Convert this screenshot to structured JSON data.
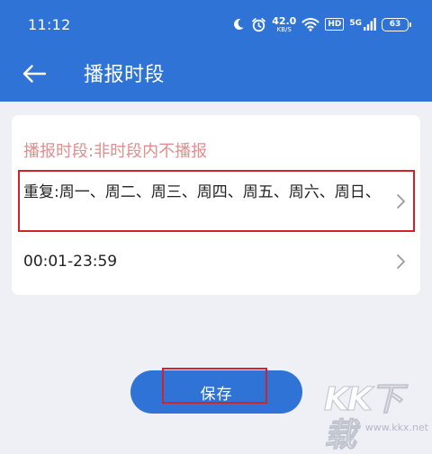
{
  "status_bar": {
    "time": "11:12",
    "net_speed_value": "42.0",
    "net_speed_unit": "KB/S",
    "hd_badge": "HD",
    "network_type": "5G",
    "battery_level": "63"
  },
  "app_bar": {
    "title": "播报时段",
    "back_icon": "arrow-left-icon"
  },
  "card": {
    "hint": "播报时段:非时段内不播报",
    "repeat_row": {
      "text": "重复:周一、周二、周三、周四、周五、周六、周日、"
    },
    "time_row": {
      "text": "00:01-23:59"
    },
    "chevron_icon": "chevron-right-icon"
  },
  "save_button": {
    "label": "保存"
  },
  "watermark": {
    "logo": "KK下载",
    "url": "www.kkx.net"
  },
  "colors": {
    "primary": "#2f73d6",
    "background": "#eef0f5",
    "hint_text": "#e08e8e",
    "highlight": "#d2232a",
    "card": "#ffffff"
  }
}
